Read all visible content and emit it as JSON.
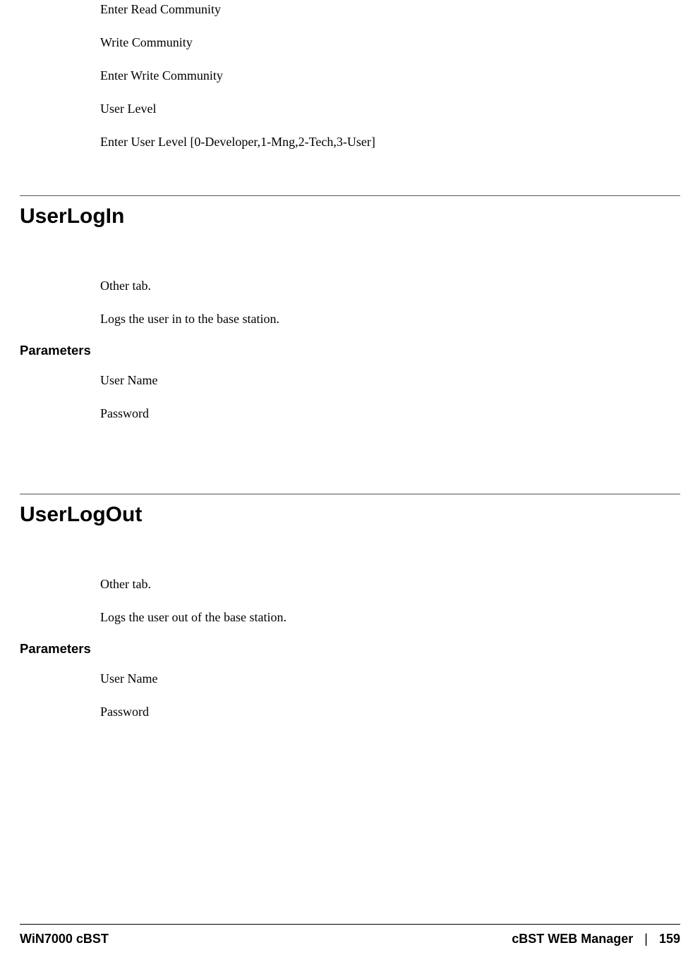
{
  "top_section": {
    "lines": [
      "Enter Read Community",
      "Write Community",
      "Enter Write Community",
      "User Level",
      "Enter User Level [0-Developer,1-Mng,2-Tech,3-User]"
    ]
  },
  "sections": [
    {
      "heading": "UserLogIn",
      "intro": [
        "Other tab.",
        "Logs the user in to the base station."
      ],
      "params_label": "Parameters",
      "params": [
        "User Name",
        "Password"
      ]
    },
    {
      "heading": "UserLogOut",
      "intro": [
        "Other tab.",
        "Logs the user out of the base station."
      ],
      "params_label": "Parameters",
      "params": [
        "User Name",
        "Password"
      ]
    }
  ],
  "footer": {
    "left": "WiN7000 cBST",
    "right_title": "cBST WEB Manager",
    "separator": "|",
    "page": "159"
  }
}
